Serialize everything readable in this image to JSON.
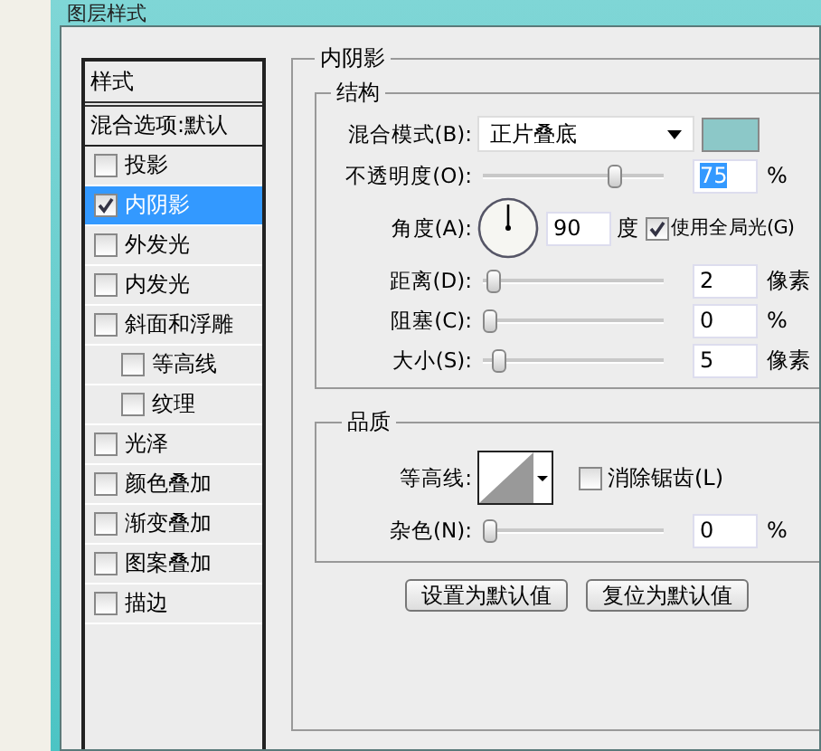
{
  "window": {
    "title": "图层样式"
  },
  "styles_panel": {
    "header": "样式",
    "blend_options": "混合选项:默认",
    "items": [
      {
        "label": "投影",
        "checked": false,
        "selected": false
      },
      {
        "label": "内阴影",
        "checked": true,
        "selected": true
      },
      {
        "label": "外发光",
        "checked": false,
        "selected": false
      },
      {
        "label": "内发光",
        "checked": false,
        "selected": false
      },
      {
        "label": "斜面和浮雕",
        "checked": false,
        "selected": false,
        "children": [
          {
            "label": "等高线",
            "checked": false,
            "selected": false
          },
          {
            "label": "纹理",
            "checked": false,
            "selected": false
          }
        ]
      },
      {
        "label": "光泽",
        "checked": false,
        "selected": false
      },
      {
        "label": "颜色叠加",
        "checked": false,
        "selected": false
      },
      {
        "label": "渐变叠加",
        "checked": false,
        "selected": false
      },
      {
        "label": "图案叠加",
        "checked": false,
        "selected": false
      },
      {
        "label": "描边",
        "checked": false,
        "selected": false
      }
    ]
  },
  "inner_shadow": {
    "title": "内阴影",
    "structure": {
      "title": "结构",
      "blend_mode": {
        "label": "混合模式(B):",
        "value": "正片叠底",
        "color": "#8cc8c8"
      },
      "opacity": {
        "label": "不透明度(O):",
        "level": 0.75,
        "value": "75",
        "unit": "%",
        "text_selected": true
      },
      "angle": {
        "label": "角度(A):",
        "value": "90",
        "unit": "度",
        "global_light": {
          "label": "使用全局光(G)",
          "checked": true
        }
      },
      "sliders": [
        {
          "label": "距离(D):",
          "level": 0.02,
          "value": "2",
          "unit": "像素"
        },
        {
          "label": "阻塞(C):",
          "level": 0,
          "value": "0",
          "unit": "%"
        },
        {
          "label": "大小(S):",
          "level": 0.05,
          "value": "5",
          "unit": "像素"
        }
      ]
    },
    "quality": {
      "title": "品质",
      "contour": {
        "label": "等高线:"
      },
      "anti_alias": {
        "label": "消除锯齿(L)",
        "checked": false
      },
      "noise": {
        "label": "杂色(N):",
        "level": 0,
        "value": "0",
        "unit": "%"
      }
    },
    "buttons": [
      "设置为默认值",
      "复位为默认值"
    ]
  }
}
